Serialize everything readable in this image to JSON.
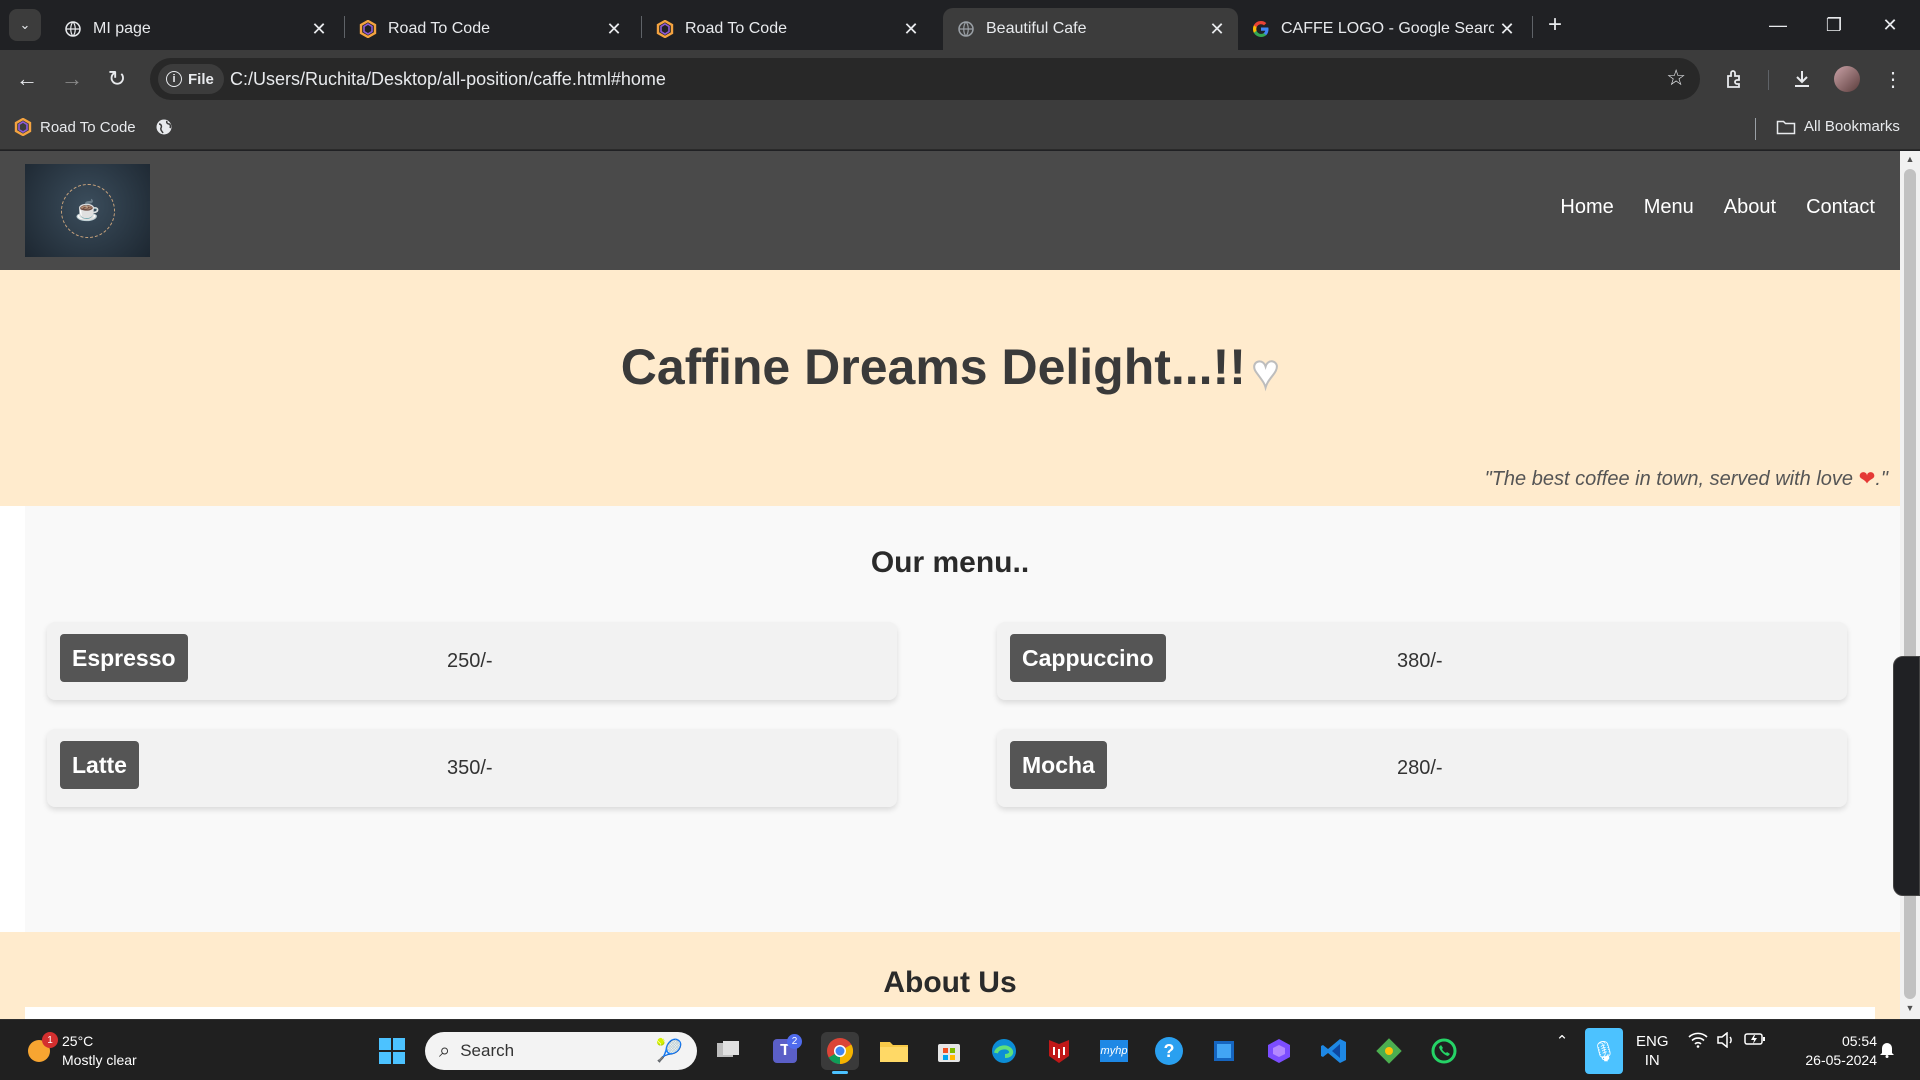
{
  "browser": {
    "tabs": [
      {
        "title": "MI page",
        "icon": "globe-icon",
        "active": false
      },
      {
        "title": "Road To Code",
        "icon": "road-to-code-icon",
        "active": false
      },
      {
        "title": "Road To Code",
        "icon": "road-to-code-icon",
        "active": false
      },
      {
        "title": "Beautiful Cafe",
        "icon": "globe-icon",
        "active": true
      },
      {
        "title": "CAFFE LOGO - Google Search",
        "icon": "google-icon",
        "active": false
      }
    ],
    "address": {
      "chip_label": "File",
      "url": "C:/Users/Ruchita/Desktop/all-position/caffe.html#home"
    },
    "bookmarks": [
      {
        "label": "Road To Code",
        "icon": "road-to-code-icon"
      }
    ],
    "all_bookmarks_label": "All Bookmarks"
  },
  "site": {
    "nav": [
      "Home",
      "Menu",
      "About",
      "Contact"
    ],
    "hero_title": "Caffine Dreams Delight...!!",
    "tagline_before": "\"The best coffee in town, served with love ",
    "tagline_after": ".\"",
    "menu_heading": "Our menu..",
    "menu_items": [
      {
        "name": "Espresso",
        "price": "250/-"
      },
      {
        "name": "Cappuccino",
        "price": "380/-"
      },
      {
        "name": "Latte",
        "price": "350/-"
      },
      {
        "name": "Mocha",
        "price": "280/-"
      }
    ],
    "about_heading": "About Us"
  },
  "taskbar": {
    "weather_temp": "25°C",
    "weather_desc": "Mostly clear",
    "weather_badge": "1",
    "search_placeholder": "Search",
    "teams_badge": "2",
    "lang_top": "ENG",
    "lang_bottom": "IN",
    "time": "05:54",
    "date": "26-05-2024"
  },
  "colors": {
    "header_bg": "#4a4a4a",
    "hero_bg": "#ffebcd",
    "menu_bg": "#f9f9f9",
    "menu_name_bg": "#555555",
    "browser_bg": "#202124"
  }
}
